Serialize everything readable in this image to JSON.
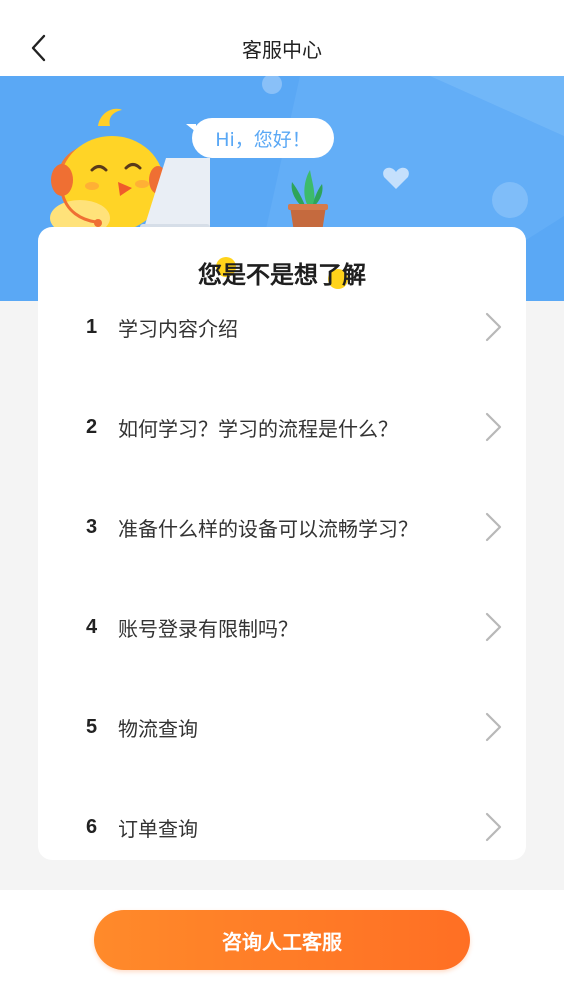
{
  "header": {
    "title": "客服中心",
    "back_icon": "chevron-left-icon"
  },
  "banner": {
    "greeting": "Hi，您好！",
    "colors": {
      "background": "#5aa8f5"
    }
  },
  "card": {
    "title": "您是不是想了解",
    "questions": [
      {
        "num": "1",
        "text": "学习内容介绍"
      },
      {
        "num": "2",
        "text": "如何学习？学习的流程是什么？"
      },
      {
        "num": "3",
        "text": "准备什么样的设备可以流畅学习？"
      },
      {
        "num": "4",
        "text": "账号登录有限制吗？"
      },
      {
        "num": "5",
        "text": "物流查询"
      },
      {
        "num": "6",
        "text": "订单查询"
      }
    ]
  },
  "footer": {
    "cta_label": "咨询人工客服",
    "colors": {
      "accent": "#ff7a28"
    }
  }
}
